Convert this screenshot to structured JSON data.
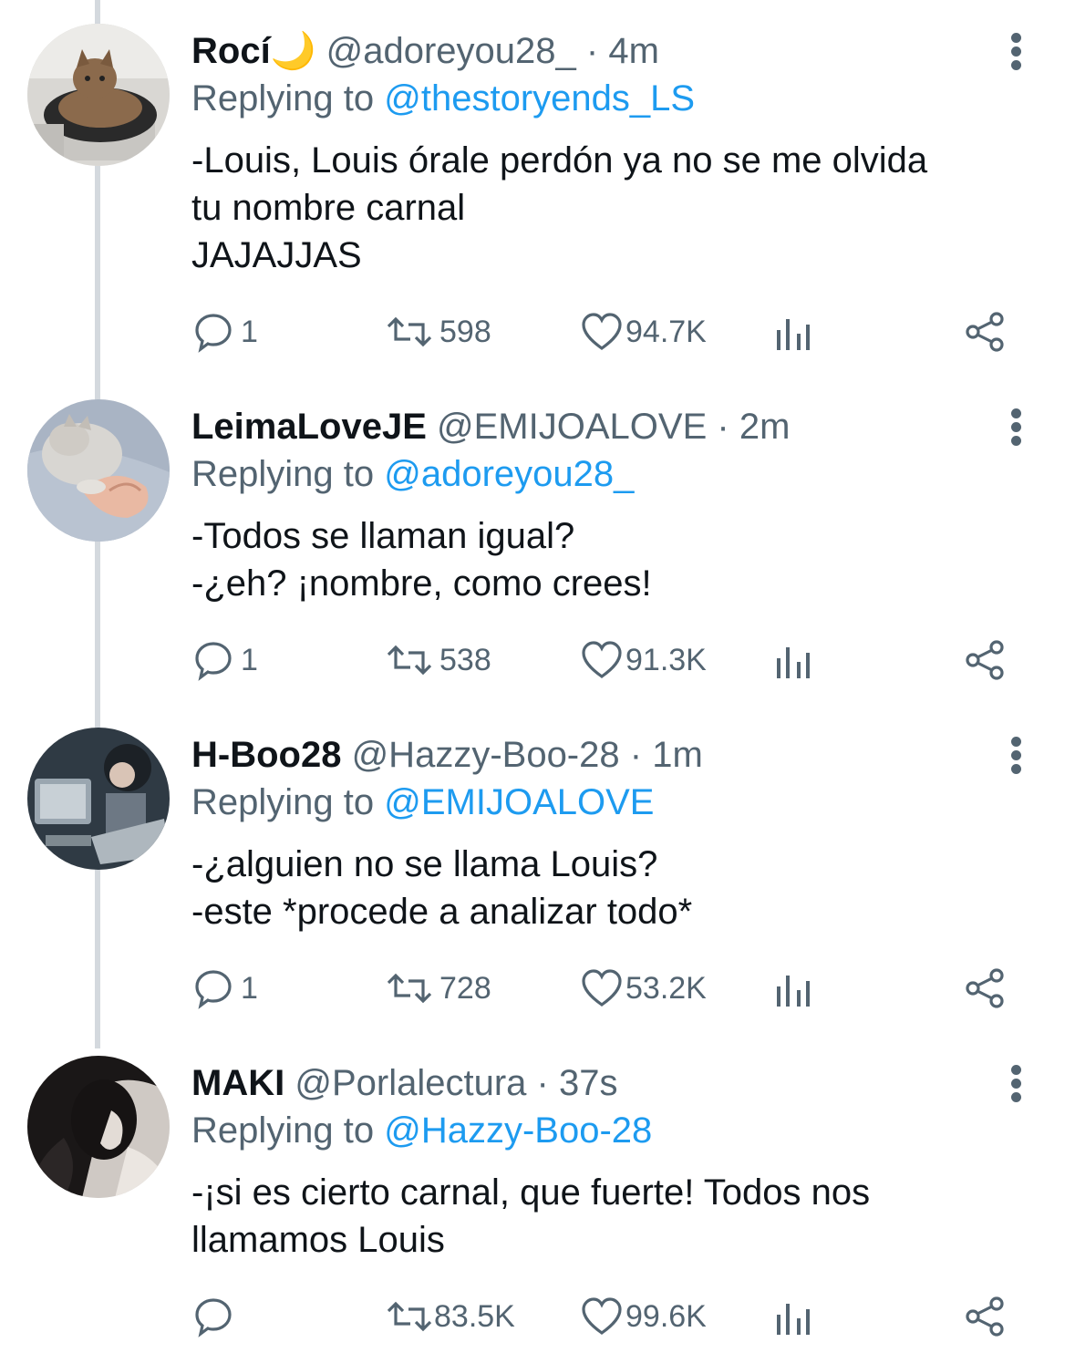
{
  "tweets": [
    {
      "name": "Rocí",
      "name_emoji": "🌙",
      "handle": "@adoreyou28_",
      "time": "4m",
      "reply_prefix": "Replying to",
      "reply_to": "@thestoryends_LS",
      "lines": [
        "-Louis, Louis órale perdón ya no se me olvida",
        "tu nombre carnal",
        "JAJAJJAS"
      ],
      "replies": "1",
      "retweets": "598",
      "likes": "94.7K",
      "avatar_icon": "cat-in-pan-avatar"
    },
    {
      "name": "LeimaLoveJE",
      "name_emoji": "",
      "handle": "@EMIJOALOVE",
      "time": "2m",
      "reply_prefix": "Replying to",
      "reply_to": "@adoreyou28_",
      "lines": [
        "-Todos se llaman igual?",
        "-¿eh? ¡nombre, como crees!"
      ],
      "replies": "1",
      "retweets": "538",
      "likes": "91.3K",
      "avatar_icon": "kitten-hand-heart-avatar"
    },
    {
      "name": "H-Boo28",
      "name_emoji": "",
      "handle": "@Hazzy-Boo-28",
      "time": "1m",
      "reply_prefix": "Replying to",
      "reply_to": "@EMIJOALOVE",
      "lines": [
        "-¿alguien no se llama Louis?",
        "-este *procede a analizar todo*"
      ],
      "replies": "1",
      "retweets": "728",
      "likes": "53.2K",
      "avatar_icon": "girl-with-tv-avatar"
    },
    {
      "name": "MAKI",
      "name_emoji": "",
      "handle": "@Porlalectura",
      "time": "37s",
      "reply_prefix": "Replying to",
      "reply_to": "@Hazzy-Boo-28",
      "lines": [
        "-¡si es cierto carnal, que fuerte! Todos nos",
        "llamamos Louis"
      ],
      "replies": "",
      "retweets": "83.5K",
      "likes": "99.6K",
      "avatar_icon": "dark-hair-girl-avatar"
    }
  ],
  "separator": "·",
  "colors": {
    "link": "#1d9bf0",
    "secondary_text": "#536471",
    "primary_text": "#0f1419",
    "thread_line": "#d4d9de"
  },
  "icons": [
    "reply-icon",
    "retweet-icon",
    "like-icon",
    "analytics-icon",
    "share-icon",
    "more-options-icon"
  ]
}
